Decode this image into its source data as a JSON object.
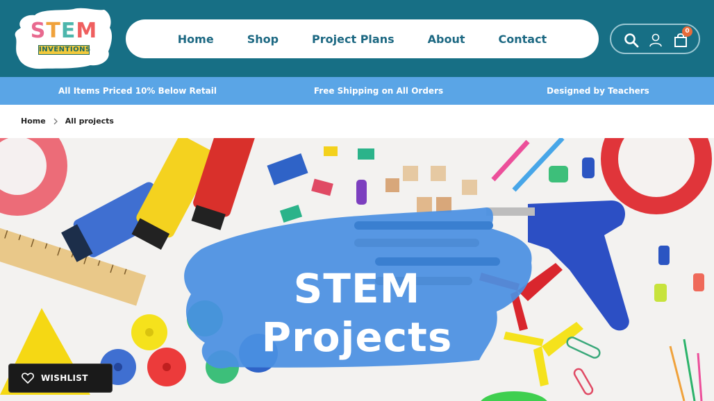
{
  "logo": {
    "letters": [
      {
        "char": "S",
        "color": "#e86a8f"
      },
      {
        "char": "T",
        "color": "#f0a23b"
      },
      {
        "char": "E",
        "color": "#4db6ac"
      },
      {
        "char": "M",
        "color": "#ef5f5f"
      }
    ],
    "tagline": "INVENTIONS"
  },
  "nav": {
    "items": [
      {
        "label": "Home"
      },
      {
        "label": "Shop"
      },
      {
        "label": "Project Plans"
      },
      {
        "label": "About"
      },
      {
        "label": "Contact"
      }
    ]
  },
  "header_icons": {
    "search": "search-icon",
    "account": "user-icon",
    "cart": "shopping-bag-icon",
    "cart_count": "0"
  },
  "promo": {
    "items": [
      {
        "text": "All Items Priced 10% Below Retail"
      },
      {
        "text": "Free Shipping on All Orders"
      },
      {
        "text": "Designed by Teachers"
      }
    ]
  },
  "breadcrumb": {
    "items": [
      {
        "label": "Home"
      },
      {
        "label": "All projects"
      }
    ]
  },
  "hero": {
    "title_line1": "STEM",
    "title_line2": "Projects"
  },
  "wishlist": {
    "label": "WISHLIST",
    "icon": "heart-icon"
  },
  "colors": {
    "header_bg": "#176f85",
    "nav_text": "#1c6882",
    "promo_bg": "#5aa5e6",
    "hero_brush": "#4a90e2",
    "badge": "#e96b3a"
  }
}
